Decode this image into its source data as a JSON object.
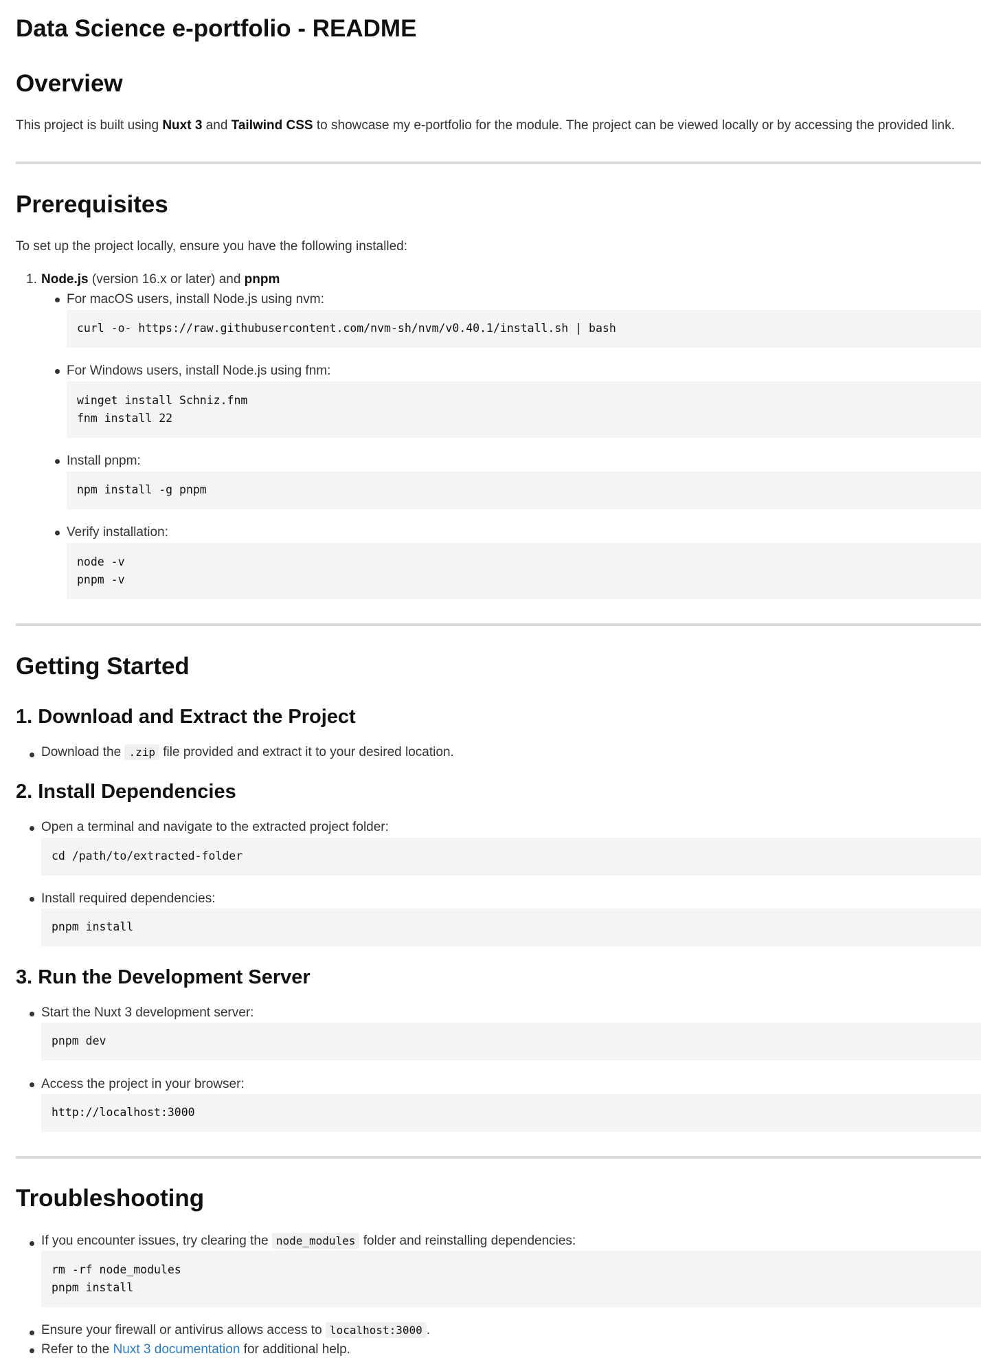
{
  "title": "Data Science e-portfolio - README",
  "overview": {
    "heading": "Overview",
    "text_before": "This project is built using ",
    "bold1": "Nuxt 3",
    "text_mid": " and ",
    "bold2": "Tailwind CSS",
    "text_after": " to showcase my e-portfolio for the module. The project can be viewed locally or by accessing the provided link."
  },
  "prerequisites": {
    "heading": "Prerequisites",
    "intro": "To set up the project locally, ensure you have the following installed:",
    "item_number": "1.",
    "item_bold1": "Node.js",
    "item_text": " (version 16.x or later) and ",
    "item_bold2": "pnpm",
    "sub": [
      {
        "label": "For macOS users, install Node.js using nvm:",
        "code": [
          "curl -o- https://raw.githubusercontent.com/nvm-sh/nvm/v0.40.1/install.sh | bash"
        ]
      },
      {
        "label": "For Windows users, install Node.js using fnm:",
        "code": [
          "winget install Schniz.fnm",
          "fnm install 22"
        ]
      },
      {
        "label": "Install pnpm:",
        "code": [
          "npm install -g pnpm"
        ]
      },
      {
        "label": "Verify installation:",
        "code": [
          "node -v",
          "pnpm -v"
        ]
      }
    ]
  },
  "getting_started": {
    "heading": "Getting Started",
    "step1": {
      "heading": "1. Download and Extract the Project",
      "text_before": "Download the ",
      "code": ".zip",
      "text_after": " file provided and extract it to your desired location."
    },
    "step2": {
      "heading": "2. Install Dependencies",
      "items": [
        {
          "label": "Open a terminal and navigate to the extracted project folder:",
          "code": [
            "cd /path/to/extracted-folder"
          ]
        },
        {
          "label": "Install required dependencies:",
          "code": [
            "pnpm install"
          ]
        }
      ]
    },
    "step3": {
      "heading": "3. Run the Development Server",
      "items": [
        {
          "label": "Start the Nuxt 3 development server:",
          "code": [
            "pnpm dev"
          ]
        },
        {
          "label": "Access the project in your browser:",
          "code": [
            "http://localhost:3000"
          ]
        }
      ]
    }
  },
  "troubleshooting": {
    "heading": "Troubleshooting",
    "item1_before": "If you encounter issues, try clearing the ",
    "item1_code": "node_modules",
    "item1_after": " folder and reinstalling dependencies:",
    "item1_block": [
      "rm -rf node_modules",
      "pnpm install"
    ],
    "item2_before": "Ensure your firewall or antivirus allows access to ",
    "item2_code": "localhost:3000",
    "item2_after": ".",
    "item3_before": "Refer to the ",
    "item3_link": "Nuxt 3 documentation",
    "item3_after": " for additional help."
  }
}
